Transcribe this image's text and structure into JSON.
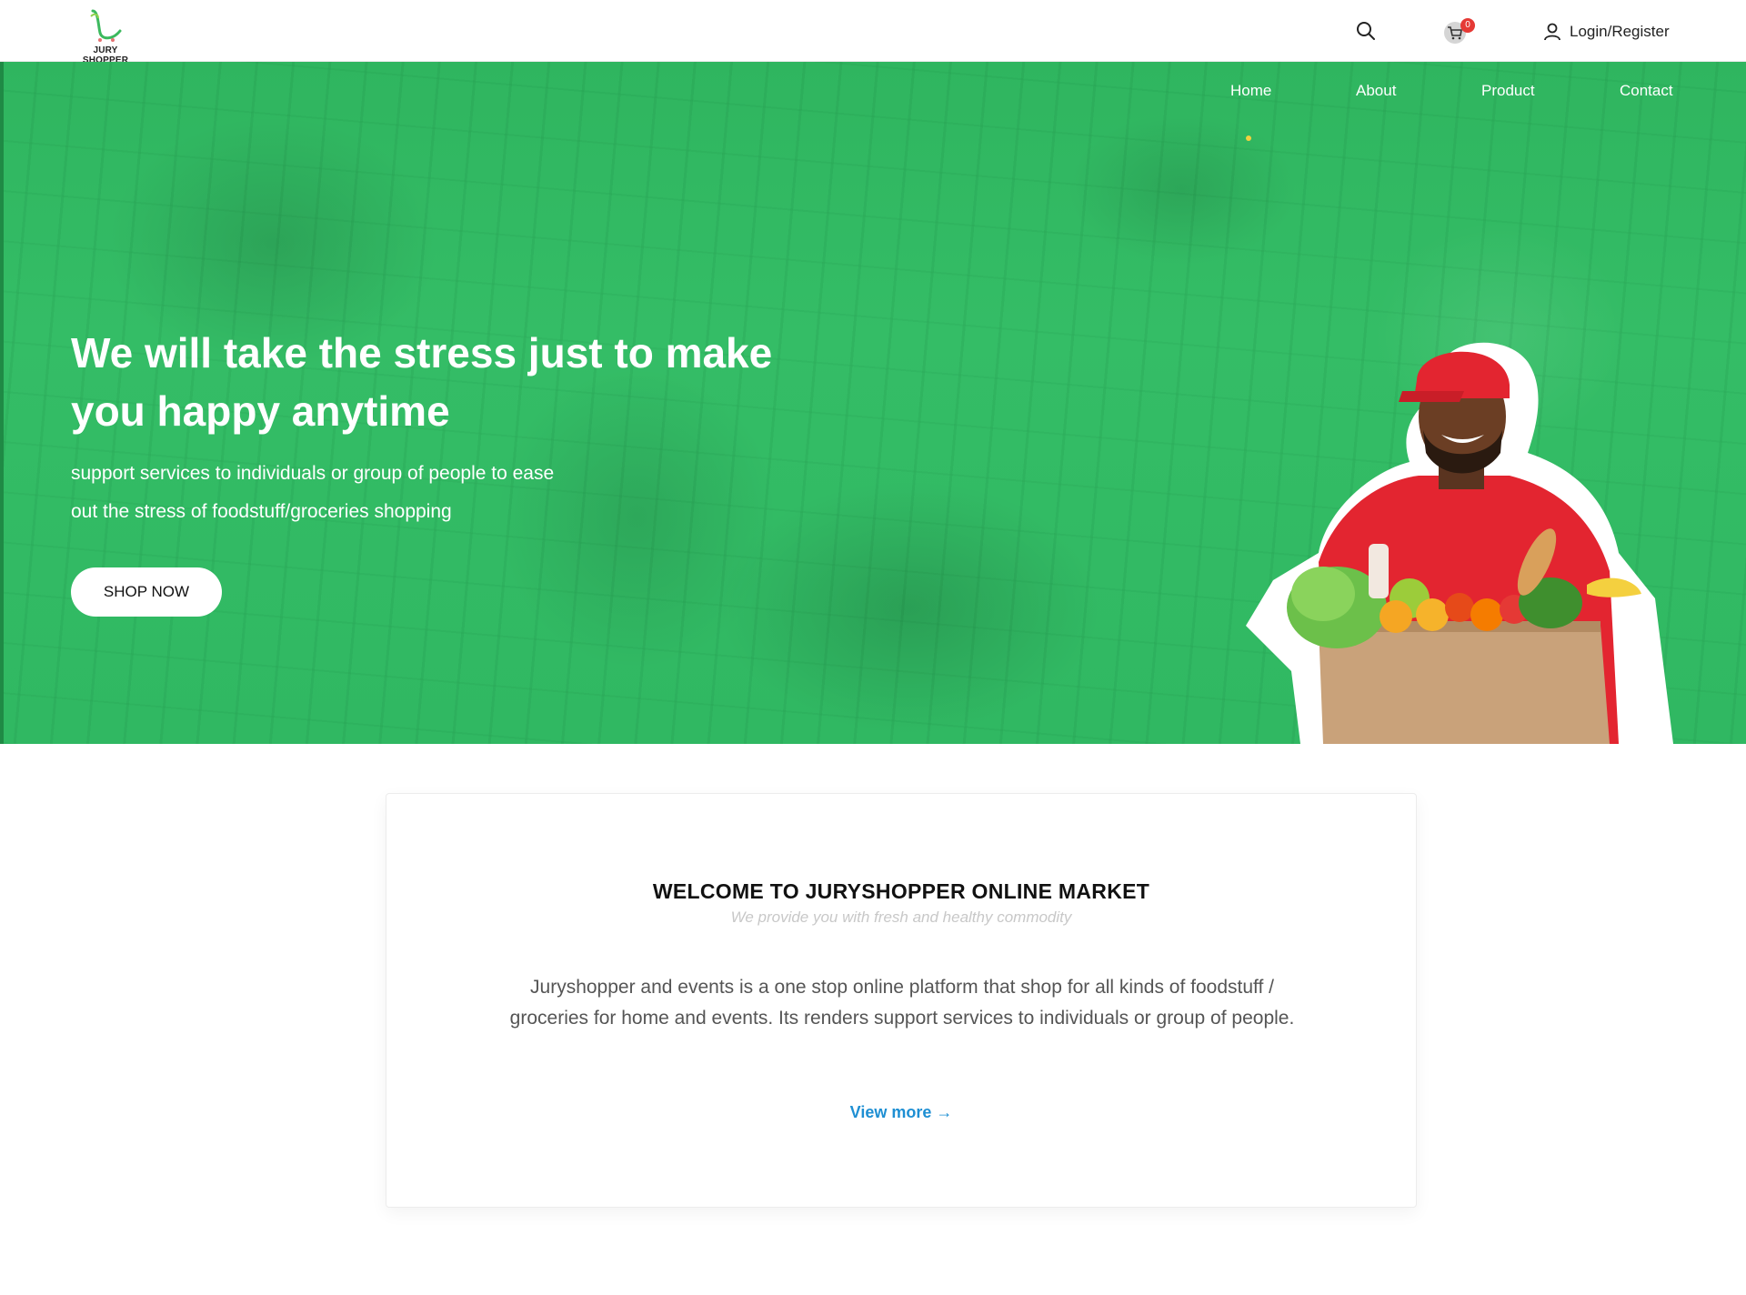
{
  "header": {
    "logo_text": "JURY SHOPPER",
    "cart_count": "0",
    "login_label": "Login/Register"
  },
  "nav": {
    "items": [
      {
        "label": "Home",
        "active": true
      },
      {
        "label": "About"
      },
      {
        "label": "Product"
      },
      {
        "label": "Contact"
      }
    ]
  },
  "hero": {
    "title": "We will take the stress just to make you happy anytime",
    "subtitle": "support services to individuals or group of people to ease out the stress of foodstuff/groceries shopping",
    "cta_label": "SHOP NOW"
  },
  "welcome": {
    "title": "WELCOME TO JURYSHOPPER ONLINE MARKET",
    "tagline": "We provide you with fresh and healthy commodity",
    "body": "Juryshopper and events is a one stop online platform that shop for all kinds of foodstuff / groceries for home and events. Its renders support services to individuals or group of people.",
    "link_label": "View more →"
  },
  "colors": {
    "hero_green": "#34bd66",
    "accent_yellow": "#f4d03f",
    "link_blue": "#1e8fd3",
    "badge_red": "#e53935"
  },
  "icons": [
    "search-icon",
    "cart-icon",
    "user-icon"
  ]
}
